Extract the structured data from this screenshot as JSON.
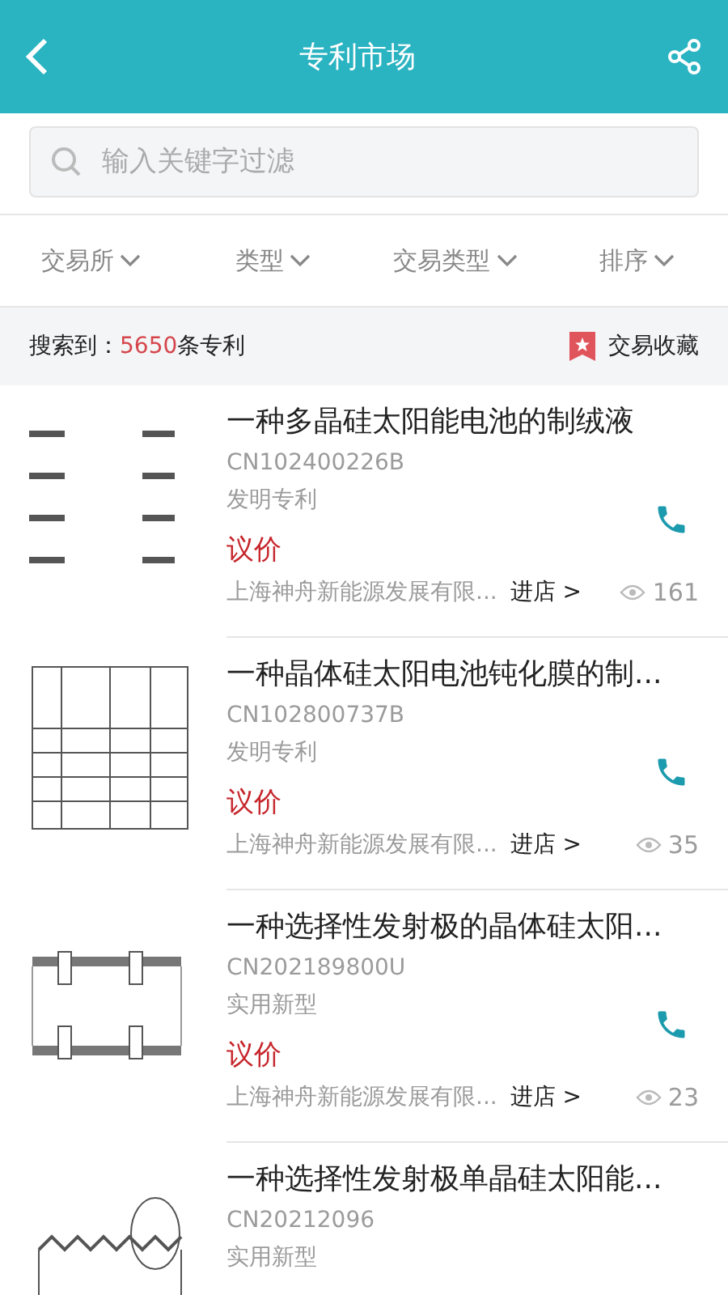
{
  "header": {
    "title": "专利市场"
  },
  "search": {
    "placeholder": "输入关键字过滤"
  },
  "filters": [
    {
      "label": "交易所"
    },
    {
      "label": "类型"
    },
    {
      "label": "交易类型"
    },
    {
      "label": "排序"
    }
  ],
  "summary": {
    "prefix": "搜索到：",
    "count": "5650",
    "suffix": "条专利",
    "favorites": "交易收藏"
  },
  "patents": [
    {
      "title": "一种多晶硅太阳能电池的制绒液",
      "number": "CN102400226B",
      "type": "发明专利",
      "price": "议价",
      "company": "上海神舟新能源发展有限...",
      "shop": "进店 >",
      "views": "161"
    },
    {
      "title": "一种晶体硅太阳电池钝化膜的制...",
      "number": "CN102800737B",
      "type": "发明专利",
      "price": "议价",
      "company": "上海神舟新能源发展有限...",
      "shop": "进店 >",
      "views": "35"
    },
    {
      "title": "一种选择性发射极的晶体硅太阳...",
      "number": "CN202189800U",
      "type": "实用新型",
      "price": "议价",
      "company": "上海神舟新能源发展有限...",
      "shop": "进店 >",
      "views": "23"
    },
    {
      "title": "一种选择性发射极单晶硅太阳能...",
      "number": "CN20212096",
      "type": "实用新型"
    }
  ]
}
